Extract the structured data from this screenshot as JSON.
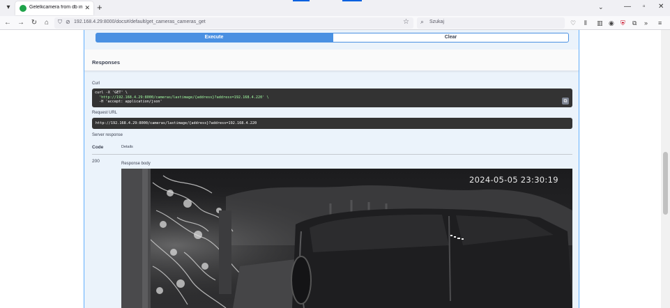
{
  "browser": {
    "tab_title": "Gelelkcamera from db image",
    "url": "192.168.4.29:8000/docs#/default/get_cameras_cameras_get",
    "search_placeholder": "Szukaj",
    "tab_close_glyph": "✕",
    "new_tab_glyph": "+"
  },
  "actions": {
    "execute_label": "Execute",
    "clear_label": "Clear"
  },
  "responses": {
    "title": "Responses",
    "curl_label": "Curl",
    "curl_lines": [
      "curl -X 'GET' \\",
      "'http://192.168.4.29:8000/cameras/lastimage/{address}?address=192.168.4.220' \\",
      "-H 'accept: application/json'"
    ],
    "request_url_label": "Request URL",
    "request_url": "http://192.168.4.29:8000/cameras/lastimage/{address}?address=192.168.4.220",
    "server_response_label": "Server response",
    "code_header": "Code",
    "details_header": "Details",
    "status_code": "200",
    "response_body_label": "Response body",
    "camera_timestamp": "2024-05-05 23:30:19"
  },
  "icons": [
    "tab-list-icon",
    "favicon-icon",
    "close-icon",
    "plus-icon",
    "chevron-down-icon",
    "minimize-icon",
    "restore-icon",
    "back-arrow-icon",
    "forward-arrow-icon",
    "reload-icon",
    "home-icon",
    "shield-icon",
    "lock-icon",
    "star-icon",
    "search-icon",
    "pocket-icon",
    "library-icon",
    "sidebar-icon",
    "account-icon",
    "extension-icon",
    "addon-icon",
    "overflow-icon",
    "menu-icon",
    "copy-icon"
  ],
  "colors": {
    "execute_bg": "#4990e2",
    "opblock_bg": "#ebf3fb",
    "opblock_border": "#61affe",
    "code_bg": "#333333",
    "curl_url_color": "#a2fca2"
  }
}
